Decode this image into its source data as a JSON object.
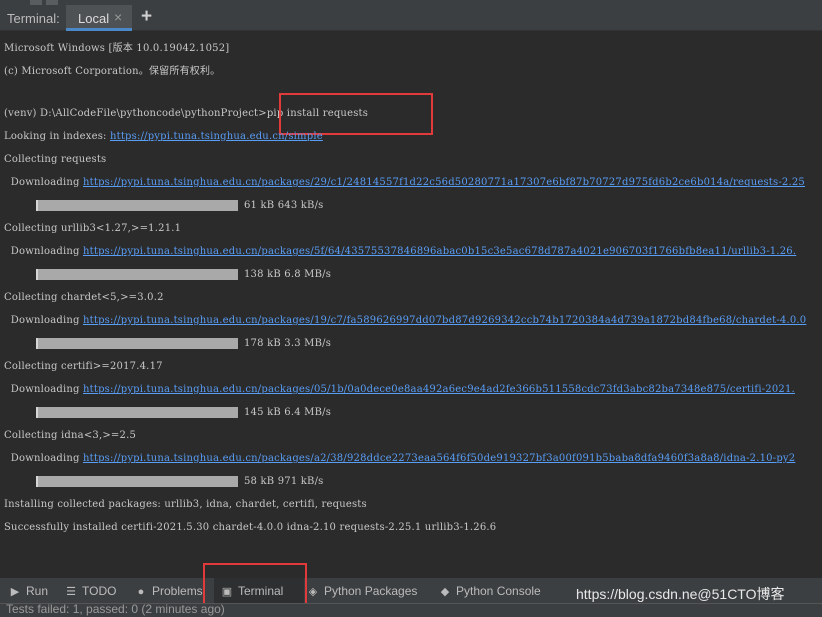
{
  "tabs": {
    "title": "Terminal:",
    "active_tab": "Local",
    "close_glyph": "×",
    "add_glyph": "+"
  },
  "terminal": {
    "l01": "Microsoft Windows [版本 10.0.19042.1052]",
    "l02": "(c) Microsoft Corporation。保留所有权利。",
    "prompt": "(venv) D:\\AllCodeFile\\pythoncode\\pythonProject>",
    "command": "pip install requests",
    "l04_text": "Looking in indexes: ",
    "l04_link": "https://pypi.tuna.tsinghua.edu.cn/simple",
    "l05": "Collecting requests",
    "dl_prefix": "  Downloading ",
    "dl1_link": "https://pypi.tuna.tsinghua.edu.cn/packages/29/c1/24814557f1d22c56d50280771a17307e6bf87b70727d975fd6b2ce6b014a/requests-2.25",
    "dl1_size": "61 kB 643 kB/s",
    "dl1_progress": 1.0,
    "c2": "Collecting urllib3<1.27,>=1.21.1",
    "dl2_link": "https://pypi.tuna.tsinghua.edu.cn/packages/5f/64/43575537846896abac0b15c3e5ac678d787a4021e906703f1766bfb8ea11/urllib3-1.26.",
    "dl2_size": "138 kB 6.8 MB/s",
    "dl2_progress": 1.0,
    "c3": "Collecting chardet<5,>=3.0.2",
    "dl3_link": "https://pypi.tuna.tsinghua.edu.cn/packages/19/c7/fa589626997dd07bd87d9269342ccb74b1720384a4d739a1872bd84fbe68/chardet-4.0.0",
    "dl3_size": "178 kB 3.3 MB/s",
    "dl3_progress": 1.0,
    "c4": "Collecting certifi>=2017.4.17",
    "dl4_link": "https://pypi.tuna.tsinghua.edu.cn/packages/05/1b/0a0dece0e8aa492a6ec9e4ad2fe366b511558cdc73fd3abc82ba7348e875/certifi-2021.",
    "dl4_size": "145 kB 6.4 MB/s",
    "dl4_progress": 1.0,
    "c5": "Collecting idna<3,>=2.5",
    "dl5_link": "https://pypi.tuna.tsinghua.edu.cn/packages/a2/38/928ddce2273eaa564f6f50de919327bf3a00f091b5baba8dfa9460f3a8a8/idna-2.10-py2",
    "dl5_size": "58 kB 971 kB/s",
    "dl5_progress": 1.0,
    "installing": "Installing collected packages: urllib3, idna, chardet, certifi, requests",
    "success": "Successfully installed certifi-2021.5.30 chardet-4.0.0 idna-2.10 requests-2.25.1 urllib3-1.26.6"
  },
  "toolbar": {
    "run": "Run",
    "todo": "TODO",
    "problems": "Problems",
    "terminal": "Terminal",
    "python_packages": "Python Packages",
    "python_console": "Python Console",
    "icons": {
      "run": "play-icon",
      "todo": "list-icon",
      "problems": "info-icon",
      "terminal": "terminal-icon",
      "python_packages": "cube-icon",
      "python_console": "python-icon"
    }
  },
  "watermark": "https://blog.csdn.ne@51CTO博客",
  "status": "Tests failed: 1, passed: 0 (2 minutes ago)",
  "colors": {
    "background": "#2b2b2b",
    "panel": "#3c3f41",
    "link": "#589df6",
    "highlight": "#e03a3a",
    "progress": "#a9a9a9"
  }
}
